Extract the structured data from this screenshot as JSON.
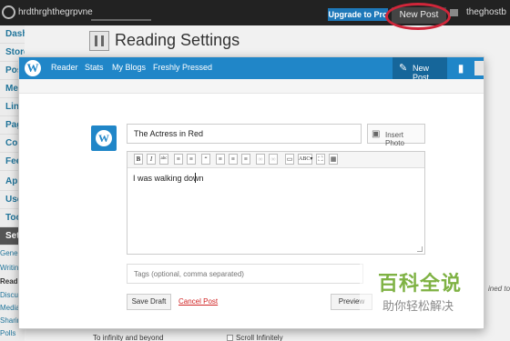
{
  "admin_bar": {
    "site_name": "hrdthrghthegrpvne",
    "upgrade_label": "Upgrade to Pro",
    "new_post_label": "New Post",
    "user_name": "theghostb"
  },
  "admin_menu": {
    "items": [
      {
        "label": "Dashboard"
      },
      {
        "label": "Store"
      },
      {
        "label": "Posts"
      },
      {
        "label": "Media"
      },
      {
        "label": "Links"
      },
      {
        "label": "Pages"
      },
      {
        "label": "Comments"
      },
      {
        "label": "Feedbacks"
      },
      {
        "label": "Appearance"
      },
      {
        "label": "Users"
      },
      {
        "label": "Tools"
      },
      {
        "label": "Settings"
      }
    ],
    "submenu": [
      {
        "label": "General"
      },
      {
        "label": "Writing"
      },
      {
        "label": "Reading"
      },
      {
        "label": "Discussion"
      },
      {
        "label": "Media"
      },
      {
        "label": "Sharing"
      },
      {
        "label": "Polls"
      }
    ]
  },
  "page": {
    "title": "Reading Settings",
    "option_row_label": "To infinity and beyond",
    "option_checkbox_label": "Scroll Infinitely",
    "right_fragment": "ined to"
  },
  "modal": {
    "nav_links": [
      "Reader",
      "Stats",
      "My Blogs",
      "Freshly Pressed"
    ],
    "new_post_label": "New Post",
    "post_title_value": "The Actress in Red",
    "insert_photo_label": "Insert Photo",
    "editor_text": "I was walking down",
    "tags_placeholder": "Tags (optional, comma separated)",
    "save_draft_label": "Save Draft",
    "cancel_post_label": "Cancel Post",
    "preview_label": "Preview"
  },
  "watermark": {
    "big": "百科全说",
    "small": "助你轻松解决"
  },
  "colors": {
    "wpcom_blue": "#2086c8",
    "admin_bar": "#222222",
    "highlight_oval": "#d0263a",
    "cancel_red": "#d02323",
    "watermark_green": "#7fb244"
  }
}
